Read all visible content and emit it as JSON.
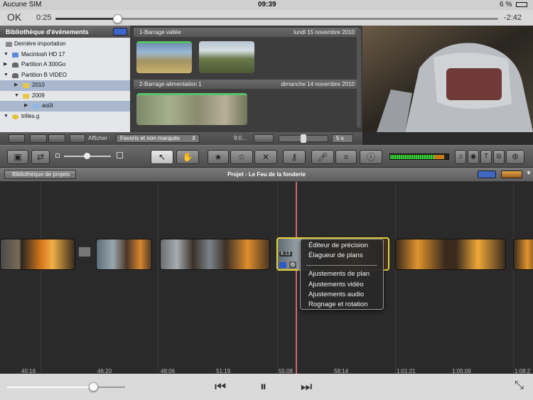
{
  "status_bar": {
    "carrier": "Aucune SIM",
    "time": "09:39",
    "battery": "6 %"
  },
  "player": {
    "done_label": "OK",
    "time_elapsed": "0:25",
    "time_remaining": "-2:42",
    "progress_fraction": 0.14,
    "volume_fraction": 0.73,
    "controls": {
      "rewind": "⏮",
      "pause": "⏸",
      "forward": "⏭",
      "collapse": "⤡"
    }
  },
  "event_library": {
    "header": "Bibliothèque d'événements",
    "items": [
      {
        "label": "Dernière importation",
        "icon": "import-icon",
        "triangle": ""
      },
      {
        "label": "Macintosh HD 17",
        "icon": "hard-disk-icon",
        "triangle": "▼"
      },
      {
        "label": "Partition A 300Go",
        "icon": "hard-disk-icon",
        "triangle": "▶"
      },
      {
        "label": "Partition B VIDEO",
        "icon": "hard-disk-icon",
        "triangle": "▼"
      },
      {
        "label": "2010",
        "icon": "folder-icon",
        "triangle": "▶"
      },
      {
        "label": "2009",
        "icon": "folder-icon",
        "triangle": "▼"
      },
      {
        "label": "août",
        "icon": "folder-icon",
        "triangle": "▶"
      },
      {
        "label": "trilles.g",
        "icon": "shared-disk-icon",
        "triangle": "▼"
      }
    ]
  },
  "events": [
    {
      "title": "1-Barrage vallée",
      "date": "lundi 15 novembre 2010"
    },
    {
      "title": "2-Barrage alimentation 1",
      "date": "dimanche 14 novembre 2010"
    }
  ],
  "event_toolbar": {
    "show_label": "Afficher :",
    "filter_value": "Favoris et non marqués",
    "duration_partial": "9:0...",
    "thumb_duration": "5 s"
  },
  "project": {
    "library_button": "Bibliothèque de projets",
    "title": "Projet - Le Feu de la fonderie",
    "selected_clip_duration": "6:13"
  },
  "context_menu": {
    "items": [
      "Éditeur de précision",
      "Élagueur de plans",
      "Ajustements de plan",
      "Ajustements vidéo",
      "Ajustements audio",
      "Rognage et rotation"
    ]
  },
  "timecodes": [
    "40:16",
    "46:20",
    "48:06",
    "51:19",
    "55:08",
    "58:14",
    "1:01:21",
    "1:05:09",
    "1:08:2"
  ]
}
